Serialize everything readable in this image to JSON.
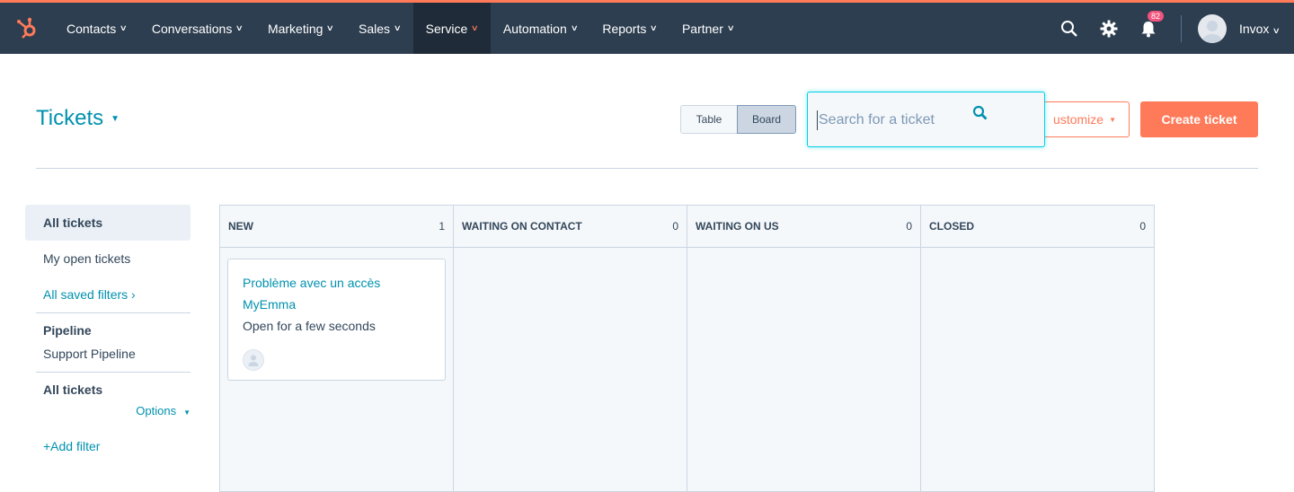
{
  "nav": {
    "items": [
      {
        "label": "Contacts"
      },
      {
        "label": "Conversations"
      },
      {
        "label": "Marketing"
      },
      {
        "label": "Sales"
      },
      {
        "label": "Service",
        "active": true
      },
      {
        "label": "Automation"
      },
      {
        "label": "Reports"
      },
      {
        "label": "Partner"
      }
    ],
    "notification_count": "82",
    "user_name": "Invox"
  },
  "header": {
    "title": "Tickets",
    "view_table": "Table",
    "view_board": "Board",
    "search_placeholder": "Search for a ticket",
    "customize_label": "ustomize",
    "create_label": "Create ticket"
  },
  "sidebar": {
    "all_tickets": "All tickets",
    "my_open": "My open tickets",
    "saved_filters": "All saved filters ›",
    "pipeline_head": "Pipeline",
    "pipeline_value": "Support Pipeline",
    "filter_head": "All tickets",
    "options": "Options",
    "add_filter": "+Add filter"
  },
  "board": {
    "columns": [
      {
        "name": "NEW",
        "count": "1"
      },
      {
        "name": "WAITING ON CONTACT",
        "count": "0"
      },
      {
        "name": "WAITING ON US",
        "count": "0"
      },
      {
        "name": "CLOSED",
        "count": "0"
      }
    ],
    "card": {
      "title_line1": "Problème avec un accès",
      "title_line2": "MyEmma",
      "status": "Open for a few seconds"
    }
  },
  "colors": {
    "accent": "#ff7a59",
    "nav_bg": "#2d3e50",
    "link": "#0091ae"
  }
}
